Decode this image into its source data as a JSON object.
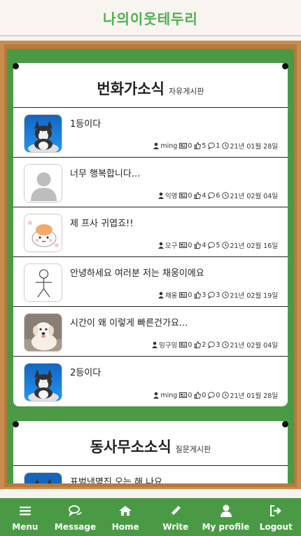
{
  "app": {
    "title": "나의이웃테두리"
  },
  "boards": [
    {
      "title": "번화가소식",
      "subtitle": "자유게시판",
      "posts": [
        {
          "title": "1등이다",
          "thumb": "husky",
          "author": "ming",
          "views": "0",
          "likes": "5",
          "comments": "1",
          "date": "21년 01월 28일"
        },
        {
          "title": "너무 행복합니다...",
          "thumb": "default-avatar",
          "author": "익명",
          "views": "0",
          "likes": "4",
          "comments": "6",
          "date": "21년 02월 04일"
        },
        {
          "title": "제 프사 귀엽죠!!",
          "thumb": "cute-character",
          "author": "오구",
          "views": "0",
          "likes": "4",
          "comments": "5",
          "date": "21년 02월 16일"
        },
        {
          "title": "안녕하세요 여러분 저는 채웅이에요",
          "thumb": "stick-figure",
          "author": "채웅",
          "views": "0",
          "likes": "3",
          "comments": "3",
          "date": "21년 02월 19일"
        },
        {
          "title": "시간이 왜 이렇게 빠른건가요...",
          "thumb": "white-dog",
          "author": "밍구밍",
          "views": "0",
          "likes": "2",
          "comments": "3",
          "date": "21년 02월 04일"
        },
        {
          "title": "2등이다",
          "thumb": "husky",
          "author": "ming",
          "views": "0",
          "likes": "0",
          "comments": "0",
          "date": "21년 01월 28일"
        }
      ]
    },
    {
      "title": "동사무소소식",
      "subtitle": "질문게시판",
      "posts": [
        {
          "title": "표범낸명진 오는 해 나요",
          "thumb": "husky"
        }
      ]
    }
  ],
  "nav": [
    {
      "label": "Menu",
      "icon": "menu-icon"
    },
    {
      "label": "Message",
      "icon": "message-icon"
    },
    {
      "label": "Home",
      "icon": "home-icon"
    },
    {
      "label": "Write",
      "icon": "pencil-icon"
    },
    {
      "label": "My profile",
      "icon": "user-icon"
    },
    {
      "label": "Logout",
      "icon": "logout-icon"
    }
  ],
  "colors": {
    "accent": "#4a9a45",
    "frame": "#c88c4e",
    "logo": "#4caf50"
  }
}
